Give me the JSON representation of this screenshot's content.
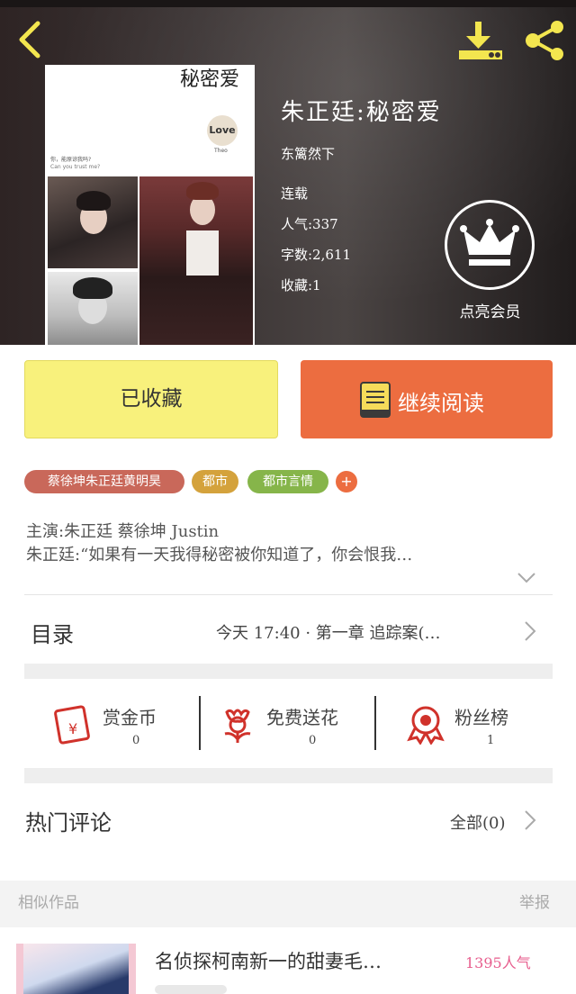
{
  "colors": {
    "accent_orange": "#ec6d40",
    "favorite_yellow": "#f8f17c",
    "icon_yellow": "#f3e64f",
    "icon_red": "#d0322b",
    "popularity_pink": "#e75d8d"
  },
  "header": {
    "back_icon": "chevron-left-icon",
    "download_icon": "download-icon",
    "share_icon": "share-icon"
  },
  "cover": {
    "title": "秘密爱",
    "love": "Love",
    "theo": "Theo",
    "question_cn": "你，能原谅我吗?",
    "question_en": "Can you trust me?"
  },
  "book": {
    "title": "朱正廷:秘密爱",
    "author": "东篱然下",
    "status": "连载",
    "popularity": "人气:337",
    "word_count": "字数:2,611",
    "favorites": "收藏:1"
  },
  "vip": {
    "label": "点亮会员",
    "icon": "crown-icon"
  },
  "actions": {
    "favorited_label": "已收藏",
    "continue_label": "继续阅读"
  },
  "tags": [
    {
      "label": "蔡徐坤朱正廷黄明昊",
      "color": "#c9685a"
    },
    {
      "label": "都市",
      "color": "#d4a23c"
    },
    {
      "label": "都市言情",
      "color": "#86b54a"
    }
  ],
  "tag_more": "+",
  "description": {
    "line1": "主演:朱正廷 蔡徐坤 Justin",
    "line2": "朱正廷:“如果有一天我得秘密被你知道了，你会恨我…"
  },
  "catalog": {
    "label": "目录",
    "latest": "今天 17:40 · 第一章 追踪案(…"
  },
  "stats": [
    {
      "label": "赏金币",
      "value": "0",
      "icon": "red-envelope-icon"
    },
    {
      "label": "免费送花",
      "value": "0",
      "icon": "flower-icon"
    },
    {
      "label": "粉丝榜",
      "value": "1",
      "icon": "medal-icon"
    }
  ],
  "comments": {
    "label": "热门评论",
    "all": "全部(0)"
  },
  "similar": {
    "label": "相似作品",
    "report": "举报",
    "items": [
      {
        "title": "名侦探柯南新一的甜妻毛…",
        "popularity": "1395人气"
      }
    ]
  }
}
